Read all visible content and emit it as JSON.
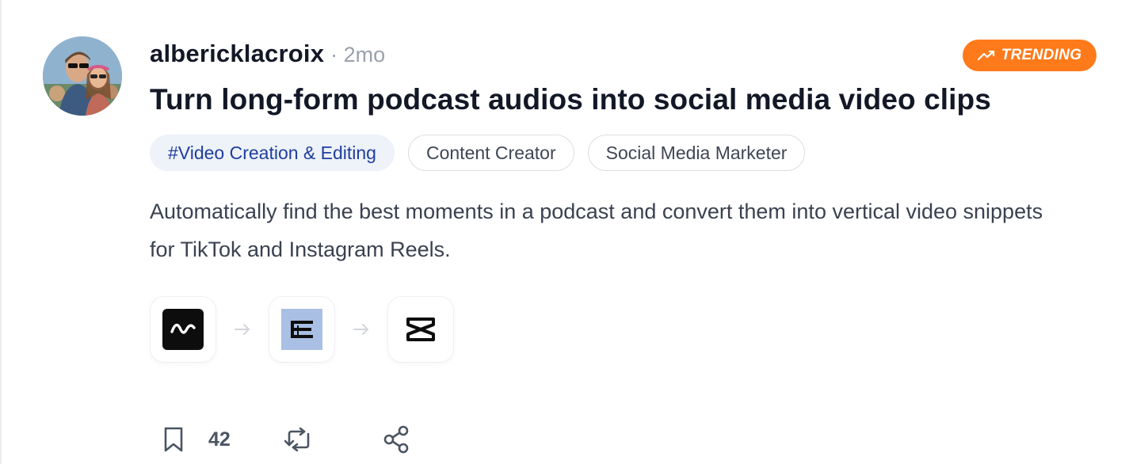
{
  "post": {
    "author": "albericklacroix",
    "time": "· 2mo",
    "badge": "TRENDING",
    "title": "Turn long-form podcast audios into social media video clips",
    "tags": [
      "#Video Creation & Editing",
      "Content Creator",
      "Social Media Marketer"
    ],
    "description": "Automatically find the best moments in a podcast and convert them into vertical video snippets for TikTok and Instagram Reels."
  },
  "tools": [
    {
      "icon": "waveform-app-icon"
    },
    {
      "icon": "stacked-e-app-icon"
    },
    {
      "icon": "capcut-icon"
    }
  ],
  "actions": {
    "bookmark_count": "42"
  },
  "colors": {
    "badge_bg": "#ff7a1a",
    "primary_tag_bg": "#eef2f9",
    "primary_tag_text": "#1f3f9c"
  }
}
